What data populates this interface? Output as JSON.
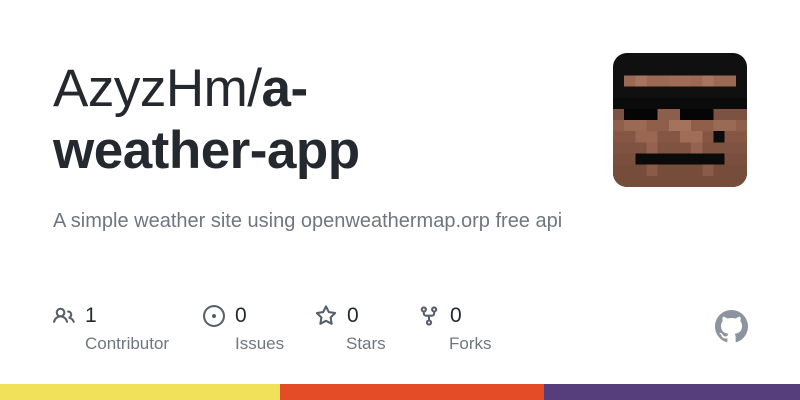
{
  "repo": {
    "owner_prefix": "AzyzHm/",
    "name_line1": "a-",
    "name_line2": "weather-app",
    "description": "A simple weather site using openweathermap.orp free api"
  },
  "avatar": {
    "icon": "pixel-avatar",
    "alt": "AzyzHm avatar"
  },
  "stats": [
    {
      "icon": "people-icon",
      "count": "1",
      "label": "Contributor"
    },
    {
      "icon": "issue-icon",
      "count": "0",
      "label": "Issues"
    },
    {
      "icon": "star-icon",
      "count": "0",
      "label": "Stars"
    },
    {
      "icon": "fork-icon",
      "count": "0",
      "label": "Forks"
    }
  ],
  "logo": {
    "icon": "github-logo-icon"
  },
  "language_bar": [
    {
      "color": "#f1e05a",
      "fraction": 0.35
    },
    {
      "color": "#e34c26",
      "fraction": 0.33
    },
    {
      "color": "#563d7c",
      "fraction": 0.32
    }
  ]
}
